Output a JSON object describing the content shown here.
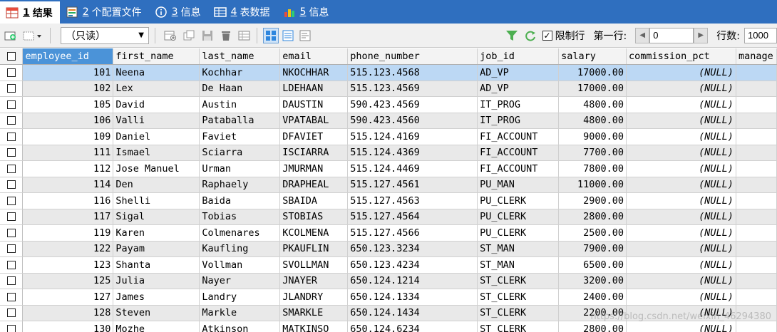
{
  "tabs": [
    {
      "num": "1",
      "label": "结果",
      "active": true
    },
    {
      "num": "2",
      "label": "个配置文件",
      "active": false
    },
    {
      "num": "3",
      "label": "信息",
      "active": false
    },
    {
      "num": "4",
      "label": "表数据",
      "active": false
    },
    {
      "num": "5",
      "label": "信息",
      "active": false
    }
  ],
  "toolbar": {
    "mode_select": "（只读）",
    "limit_rows_label": "限制行",
    "first_row_label": "第一行:",
    "first_row_value": "0",
    "row_count_label": "行数:",
    "row_count_value": "1000"
  },
  "columns": [
    "employee_id",
    "first_name",
    "last_name",
    "email",
    "phone_number",
    "job_id",
    "salary",
    "commission_pct",
    "manage"
  ],
  "rows": [
    [
      "101",
      "Neena",
      "Kochhar",
      "NKOCHHAR",
      "515.123.4568",
      "AD_VP",
      "17000.00",
      "(NULL)",
      ""
    ],
    [
      "102",
      "Lex",
      "De Haan",
      "LDEHAAN",
      "515.123.4569",
      "AD_VP",
      "17000.00",
      "(NULL)",
      ""
    ],
    [
      "105",
      "David",
      "Austin",
      "DAUSTIN",
      "590.423.4569",
      "IT_PROG",
      "4800.00",
      "(NULL)",
      ""
    ],
    [
      "106",
      "Valli",
      "Pataballa",
      "VPATABAL",
      "590.423.4560",
      "IT_PROG",
      "4800.00",
      "(NULL)",
      ""
    ],
    [
      "109",
      "Daniel",
      "Faviet",
      "DFAVIET",
      "515.124.4169",
      "FI_ACCOUNT",
      "9000.00",
      "(NULL)",
      ""
    ],
    [
      "111",
      "Ismael",
      "Sciarra",
      "ISCIARRA",
      "515.124.4369",
      "FI_ACCOUNT",
      "7700.00",
      "(NULL)",
      ""
    ],
    [
      "112",
      "Jose Manuel",
      "Urman",
      "JMURMAN",
      "515.124.4469",
      "FI_ACCOUNT",
      "7800.00",
      "(NULL)",
      ""
    ],
    [
      "114",
      "Den",
      "Raphaely",
      "DRAPHEAL",
      "515.127.4561",
      "PU_MAN",
      "11000.00",
      "(NULL)",
      ""
    ],
    [
      "116",
      "Shelli",
      "Baida",
      "SBAIDA",
      "515.127.4563",
      "PU_CLERK",
      "2900.00",
      "(NULL)",
      ""
    ],
    [
      "117",
      "Sigal",
      "Tobias",
      "STOBIAS",
      "515.127.4564",
      "PU_CLERK",
      "2800.00",
      "(NULL)",
      ""
    ],
    [
      "119",
      "Karen",
      "Colmenares",
      "KCOLMENA",
      "515.127.4566",
      "PU_CLERK",
      "2500.00",
      "(NULL)",
      ""
    ],
    [
      "122",
      "Payam",
      "Kaufling",
      "PKAUFLIN",
      "650.123.3234",
      "ST_MAN",
      "7900.00",
      "(NULL)",
      ""
    ],
    [
      "123",
      "Shanta",
      "Vollman",
      "SVOLLMAN",
      "650.123.4234",
      "ST_MAN",
      "6500.00",
      "(NULL)",
      ""
    ],
    [
      "125",
      "Julia",
      "Nayer",
      "JNAYER",
      "650.124.1214",
      "ST_CLERK",
      "3200.00",
      "(NULL)",
      ""
    ],
    [
      "127",
      "James",
      "Landry",
      "JLANDRY",
      "650.124.1334",
      "ST_CLERK",
      "2400.00",
      "(NULL)",
      ""
    ],
    [
      "128",
      "Steven",
      "Markle",
      "SMARKLE",
      "650.124.1434",
      "ST_CLERK",
      "2200.00",
      "(NULL)",
      ""
    ],
    [
      "130",
      "Mozhe",
      "Atkinson",
      "MATKINSO",
      "650.124.6234",
      "ST_CLERK",
      "2800.00",
      "(NULL)",
      ""
    ]
  ],
  "watermark": "https://blog.csdn.net/weixin_46294380",
  "colors": {
    "tabbar": "#2f6fbf",
    "selected_header": "#4b93d8",
    "current_row": "#bcd8f4"
  }
}
